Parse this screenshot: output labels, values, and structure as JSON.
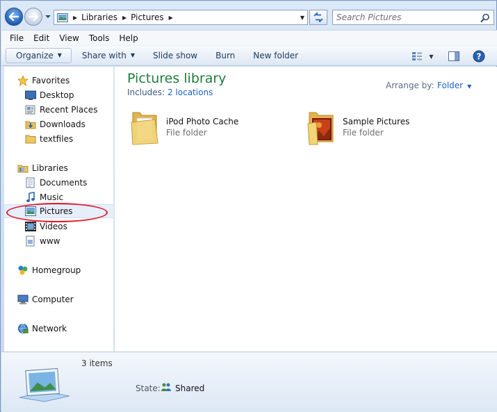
{
  "address": {
    "path": [
      "Libraries",
      "Pictures"
    ]
  },
  "search": {
    "placeholder": "Search Pictures"
  },
  "menubar": [
    "File",
    "Edit",
    "View",
    "Tools",
    "Help"
  ],
  "toolbar": {
    "organize": "Organize",
    "share_with": "Share with",
    "slide_show": "Slide show",
    "burn": "Burn",
    "new_folder": "New folder"
  },
  "nav": {
    "favorites": "Favorites",
    "desktop": "Desktop",
    "recent_places": "Recent Places",
    "downloads": "Downloads",
    "textfiles": "textfiles",
    "libraries": "Libraries",
    "documents": "Documents",
    "music": "Music",
    "pictures": "Pictures",
    "videos": "Videos",
    "www": "www",
    "homegroup": "Homegroup",
    "computer": "Computer",
    "network": "Network"
  },
  "library": {
    "title": "Pictures library",
    "includes_label": "Includes:",
    "locations": "2 locations",
    "arrange_label": "Arrange by:",
    "arrange_value": "Folder"
  },
  "items": [
    {
      "name": "iPod Photo Cache",
      "type": "File folder"
    },
    {
      "name": "Sample Pictures",
      "type": "File folder"
    }
  ],
  "details": {
    "count": "3 items",
    "state_label": "State:",
    "state_value": "Shared"
  },
  "colors": {
    "title_green": "#1e7d3a",
    "link_blue": "#1c62c6",
    "highlight_red": "#e2162a"
  }
}
